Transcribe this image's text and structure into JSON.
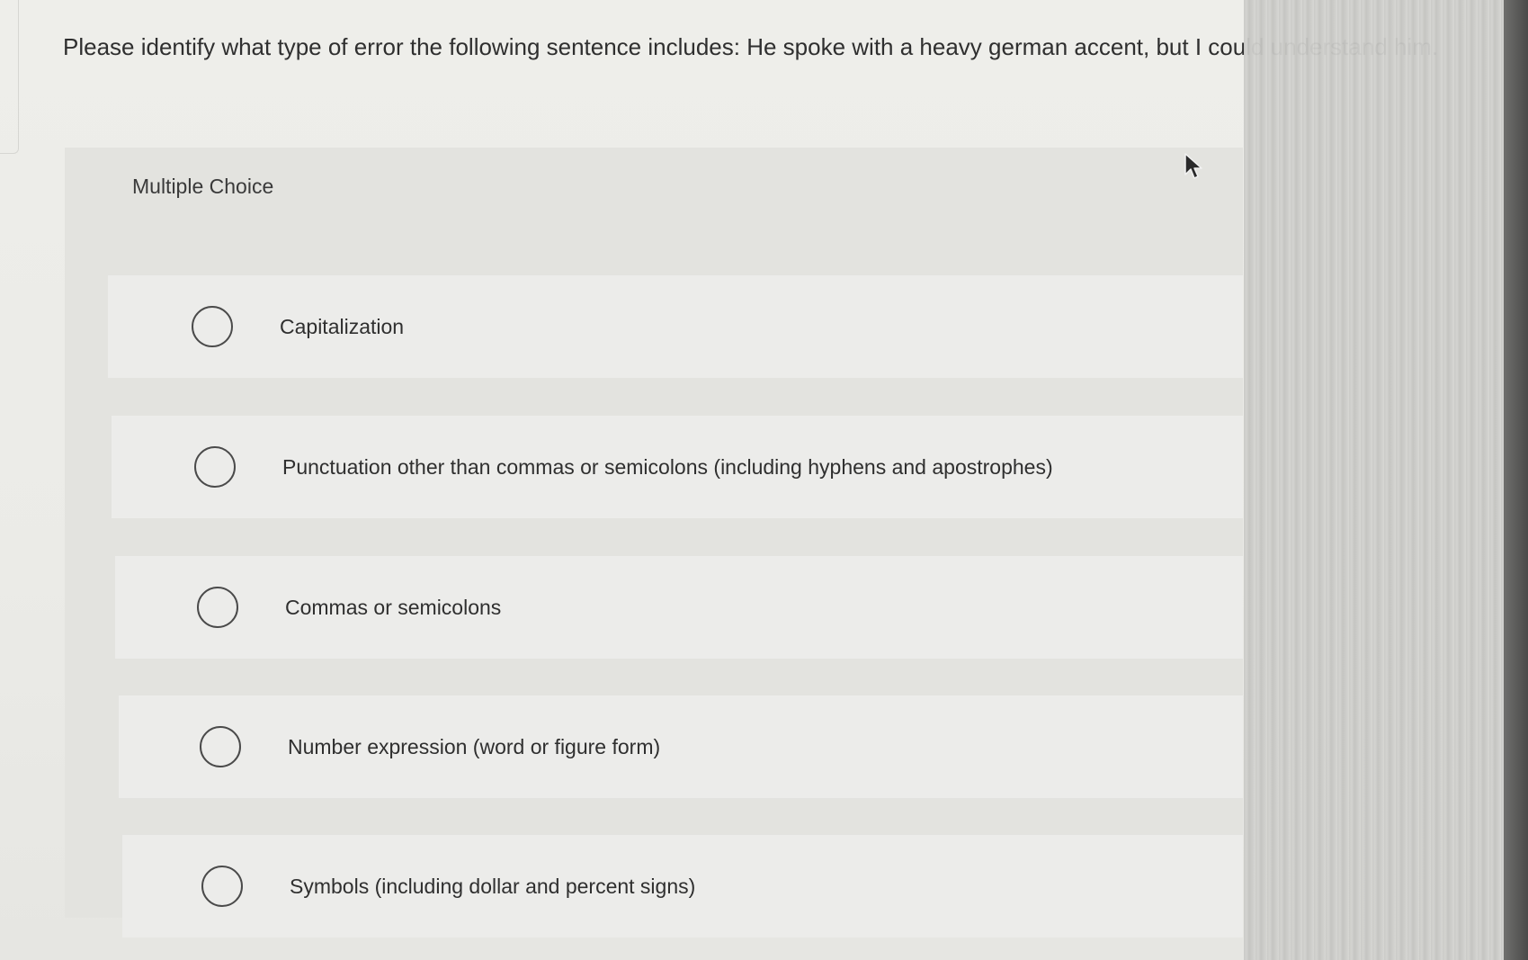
{
  "question": {
    "text": "Please identify what type of error the following sentence includes: He spoke with a heavy german accent, but I could understand him."
  },
  "quiz": {
    "type_label": "Multiple Choice",
    "options": [
      {
        "label": "Capitalization",
        "selected": false
      },
      {
        "label": "Punctuation other than commas or semicolons (including hyphens and apostrophes)",
        "selected": false
      },
      {
        "label": "Commas or semicolons",
        "selected": false
      },
      {
        "label": "Number expression (word or figure form)",
        "selected": false
      },
      {
        "label": "Symbols (including dollar and percent signs)",
        "selected": false
      }
    ]
  },
  "icons": {
    "radio": "radio-button-icon",
    "cursor": "mouse-pointer-icon"
  }
}
